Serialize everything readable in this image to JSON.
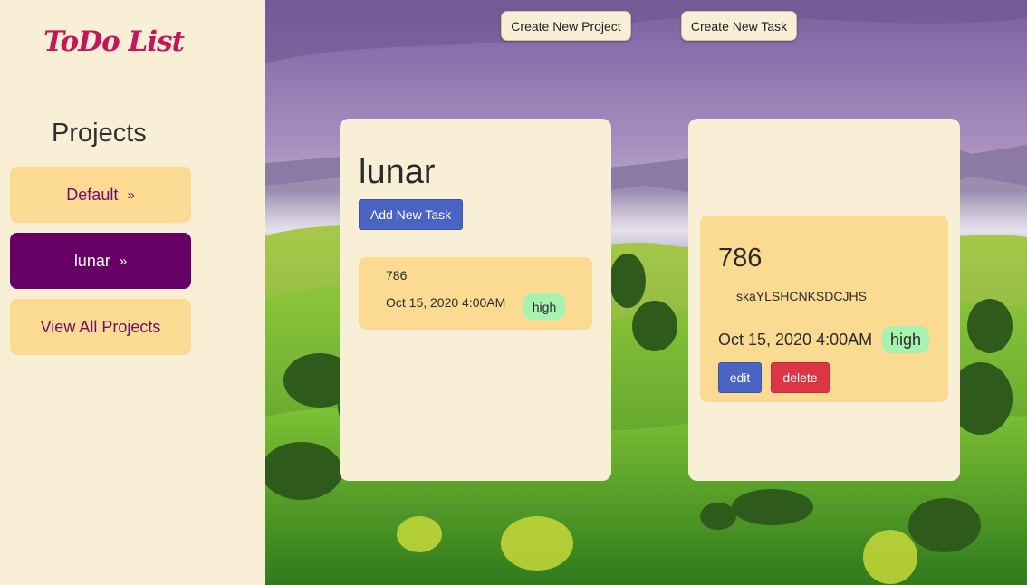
{
  "app": {
    "logo": "ToDo List"
  },
  "sidebar": {
    "heading": "Projects",
    "items": [
      {
        "label": "Default",
        "chevron": "»",
        "active": false
      },
      {
        "label": "lunar",
        "chevron": "»",
        "active": true
      },
      {
        "label": "View All Projects"
      }
    ]
  },
  "toolbar": {
    "create_project_label": "Create New Project",
    "create_task_label": "Create New Task"
  },
  "project_card": {
    "title": "lunar",
    "add_task_label": "Add New Task",
    "tasks": [
      {
        "name": "786",
        "due": "Oct 15, 2020 4:00AM",
        "priority": "high"
      }
    ]
  },
  "task_detail": {
    "name": "786",
    "description": "skaYLSHCNKSDCJHS",
    "due": "Oct 15, 2020 4:00AM",
    "priority": "high",
    "edit_label": "edit",
    "delete_label": "delete"
  },
  "colors": {
    "sidebar_bg": "#f9eed6",
    "accent_purple": "#660066",
    "item_bg": "#fbdb92",
    "primary_blue": "#4a64c4",
    "danger_red": "#dc3545",
    "priority_badge": "#a6f2b0",
    "logo": "#c2185b"
  }
}
